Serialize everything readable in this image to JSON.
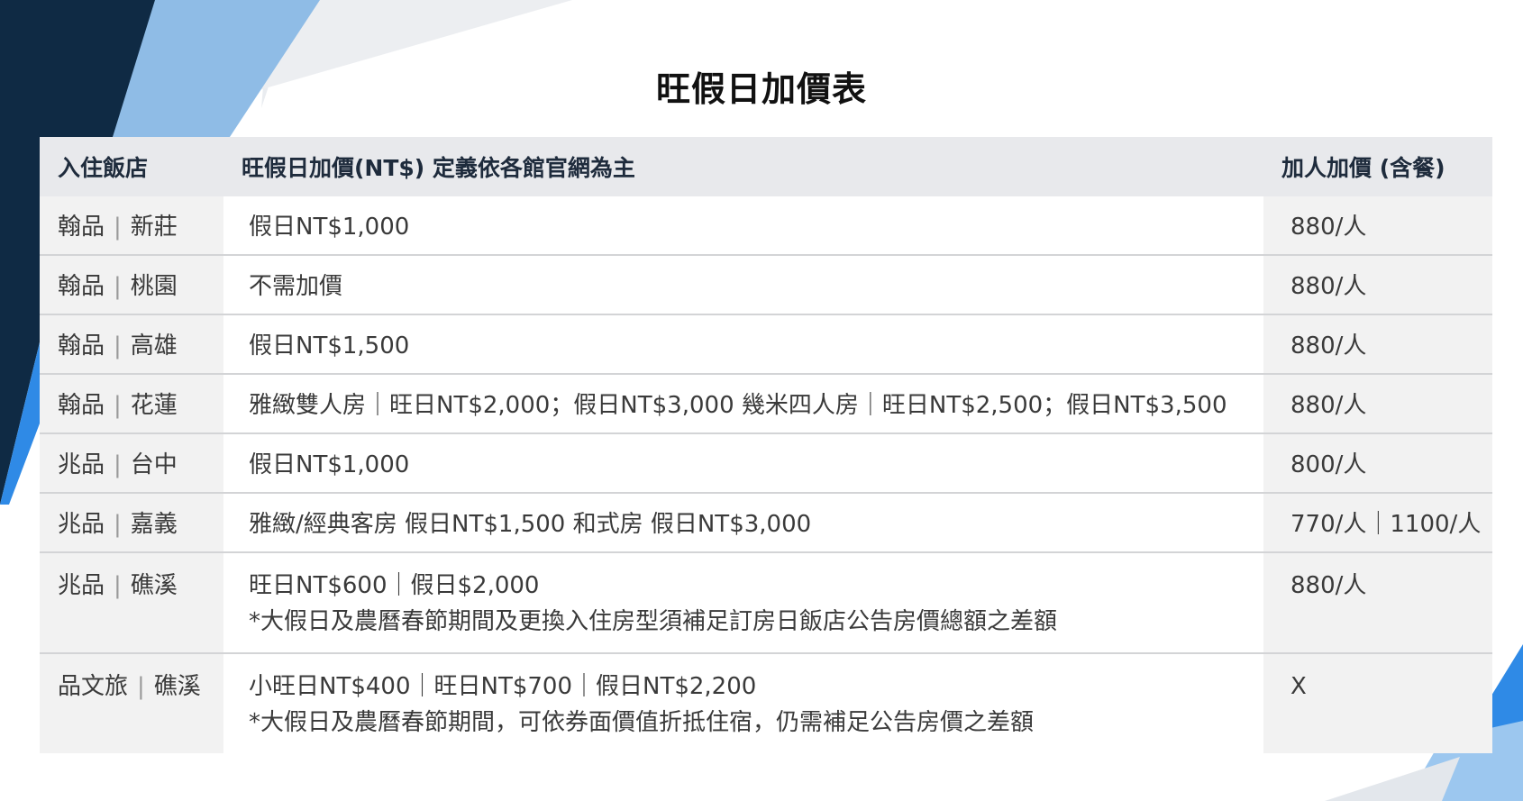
{
  "page": {
    "title": "旺假日加價表"
  },
  "table": {
    "headers": {
      "hotel": "入住飯店",
      "price": "旺假日加價(NT$) 定義依各館官網為主",
      "extra": "加人加價 (含餐)"
    },
    "rows": [
      {
        "brand": "翰品",
        "city": "新莊",
        "price": "假日NT$1,000",
        "note": "",
        "extra": "880/人"
      },
      {
        "brand": "翰品",
        "city": "桃園",
        "price": "不需加價",
        "note": "",
        "extra": "880/人"
      },
      {
        "brand": "翰品",
        "city": "高雄",
        "price": "假日NT$1,500",
        "note": "",
        "extra": "880/人"
      },
      {
        "brand": "翰品",
        "city": "花蓮",
        "price": "雅緻雙人房｜旺日NT$2,000；假日NT$3,000  幾米四人房｜旺日NT$2,500；假日NT$3,500",
        "note": "",
        "extra": "880/人"
      },
      {
        "brand": "兆品",
        "city": "台中",
        "price": "假日NT$1,000",
        "note": "",
        "extra": "800/人"
      },
      {
        "brand": "兆品",
        "city": "嘉義",
        "price": "雅緻/經典客房 假日NT$1,500    和式房 假日NT$3,000",
        "note": "",
        "extra": "770/人｜1100/人"
      },
      {
        "brand": "兆品",
        "city": "礁溪",
        "price": "旺日NT$600｜假日$2,000",
        "note": "*大假日及農曆春節期間及更換入住房型須補足訂房日飯店公告房價總額之差額",
        "extra": "880/人"
      },
      {
        "brand": "品文旅",
        "city": "礁溪",
        "price": "小旺日NT$400｜旺日NT$700｜假日NT$2,200",
        "note": "*大假日及農曆春節期間，可依券面價值折抵住宿，仍需補足公告房價之差額",
        "extra": "X"
      }
    ]
  },
  "colors": {
    "navy": "#0f2a44",
    "blue": "#2f8ae6",
    "light_blue": "#9cc7ef",
    "header_bg": "#e8e9ec"
  }
}
